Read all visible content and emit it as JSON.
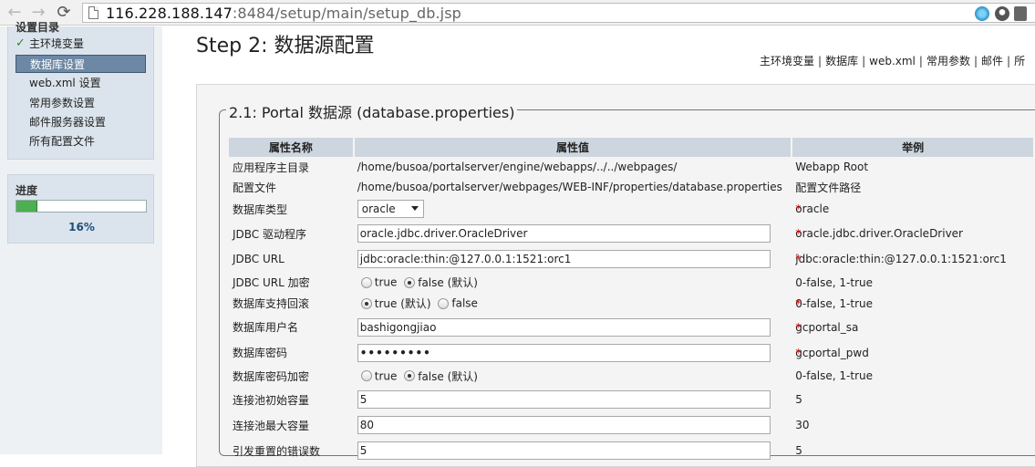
{
  "browser": {
    "url_host": "116.228.188.147",
    "url_rest": ":8484/setup/main/setup_db.jsp",
    "back_glyph": "←",
    "forward_glyph": "→",
    "reload_glyph": "⟳"
  },
  "sidebar": {
    "section_title": "设置目录",
    "items": [
      {
        "label": "主环境变量",
        "checked": true
      },
      {
        "label": "数据库设置",
        "active": true
      },
      {
        "label": "web.xml 设置"
      },
      {
        "label": "常用参数设置"
      },
      {
        "label": "邮件服务器设置"
      },
      {
        "label": "所有配置文件"
      }
    ],
    "progress": {
      "title": "进度",
      "value": 0.16,
      "text": "16%"
    }
  },
  "page": {
    "title": "Step 2: 数据源配置",
    "top_links": [
      "主环境变量",
      "数据库",
      "web.xml",
      "常用参数",
      "邮件",
      "所"
    ]
  },
  "section": {
    "legend": "2.1: Portal 数据源 (database.properties)",
    "headers": [
      "属性名称",
      "属性值",
      "举例"
    ],
    "rows": [
      {
        "name": "应用程序主目录",
        "value": "/home/busoa/portalserver/engine/webapps/../../webpages/",
        "example": "Webapp Root"
      },
      {
        "name": "配置文件",
        "value": "/home/busoa/portalserver/webpages/WEB-INF/properties/database.properties",
        "example": "配置文件路径"
      },
      {
        "name": "数据库类型",
        "select": "oracle",
        "example": "oracle"
      },
      {
        "name": "JDBC 驱动程序",
        "input": "oracle.jdbc.driver.OracleDriver",
        "example": "oracle.jdbc.driver.OracleDriver"
      },
      {
        "name": "JDBC URL",
        "input": "jdbc:oracle:thin:@127.0.0.1:1521:orc1",
        "example": "jdbc:oracle:thin:@127.0.0.1:1521:orc1"
      },
      {
        "name": "JDBC URL 加密",
        "radio_true": "true",
        "radio_false": "false (默认)",
        "example": "0-false, 1-true"
      },
      {
        "name": "数据库支持回滚",
        "radio_true": "true (默认)",
        "radio_false": "false",
        "example": "0-false, 1-true"
      },
      {
        "name": "数据库用户名",
        "input": "bashigongjiao",
        "example": "gcportal_sa"
      },
      {
        "name": "数据库密码",
        "input": "•••••••••",
        "example": "gcportal_pwd"
      },
      {
        "name": "数据库密码加密",
        "radio_true": "true",
        "radio_false": "false (默认)",
        "example": "0-false, 1-true"
      },
      {
        "name": "连接池初始容量",
        "input": "5",
        "example": "5"
      },
      {
        "name": "连接池最大容量",
        "input": "80",
        "example": "30"
      },
      {
        "name": "引发重置的错误数",
        "input": "5",
        "example": "5"
      }
    ]
  },
  "colors": {
    "accent": "#6d88a4",
    "panel": "#dbe4ec",
    "progress": "#4caf50",
    "required": "#cc0000"
  }
}
